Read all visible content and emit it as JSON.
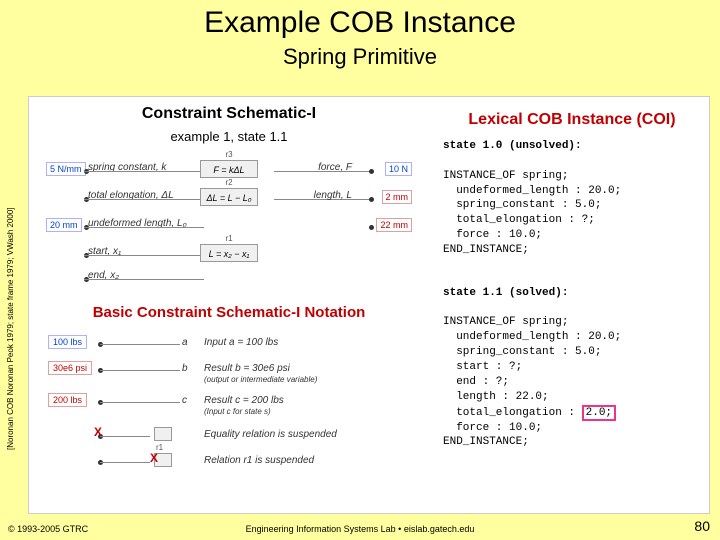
{
  "title": "Example COB Instance",
  "subtitle": "Spring Primitive",
  "sidecite": "[Noronan COB Noronan Peok 1979; state frame 1979; VWash 2000]",
  "left": {
    "heading": "Constraint Schematic-I",
    "example_label": "example 1, state 1.1",
    "rows": [
      {
        "left_tag": "5 N/mm",
        "left_label": "spring constant, k",
        "r": "r3",
        "rel": "F = kΔL",
        "right_label": "force, F",
        "right_tag": "10 N",
        "right_red": false
      },
      {
        "left_tag": "",
        "left_label": "total elongation, ΔL",
        "r": "r2",
        "rel": "ΔL = L − L₀",
        "right_label": "length, L",
        "right_tag": "2 mm",
        "right_red": true
      },
      {
        "left_tag": "20 mm",
        "left_label": "undeformed length, L₀",
        "r": "",
        "rel": "",
        "right_label": "",
        "right_tag": "22 mm",
        "right_red": true
      },
      {
        "left_tag": "",
        "left_label": "start, x₁",
        "r": "r1",
        "rel": "L = x₂ − x₁",
        "right_label": "",
        "right_tag": "",
        "right_red": false
      },
      {
        "left_tag": "",
        "left_label": "end, x₂",
        "r": "",
        "rel": "",
        "right_label": "",
        "right_tag": "",
        "right_red": false
      }
    ],
    "basic_heading": "Basic Constraint Schematic-I Notation",
    "notation": [
      {
        "box": "100 lbs",
        "box_color": "blue",
        "var": "a",
        "desc": "Input a = 100 lbs",
        "line": true,
        "dot": true
      },
      {
        "box": "30e6 psi",
        "box_color": "red",
        "var": "b",
        "desc": "Result b = 30e6 psi",
        "line": true,
        "dot": true,
        "desc2": "(output or intermediate variable)"
      },
      {
        "box": "200 lbs",
        "box_color": "red",
        "var": "c",
        "desc": "Result c = 200 lbs",
        "line": true,
        "dot": true,
        "desc2": "(Input c for state s)"
      },
      {
        "relbox": true,
        "cross_on_dot": true,
        "desc": "Equality relation is suspended"
      },
      {
        "relbox": true,
        "rlabel": "r1",
        "cross_on_box": true,
        "desc": "Relation r1 is suspended"
      }
    ]
  },
  "right": {
    "heading": "Lexical COB Instance (COI)",
    "state10_title": "state 1.0 (unsolved):",
    "state10_body": "INSTANCE_OF spring;\n  undeformed_length : 20.0;\n  spring_constant : 5.0;\n  total_elongation : ?;\n  force : 10.0;\nEND_INSTANCE;",
    "state11_title": "state 1.1 (solved):",
    "state11_body_pre": "INSTANCE_OF spring;\n  undeformed_length : 20.0;\n  spring_constant : 5.0;\n  start : ?;\n  end : ?;\n  length : 22.0;\n  total_elongation : ",
    "state11_hl": "2.0;",
    "state11_body_post": "\n  force : 10.0;\nEND_INSTANCE;"
  },
  "footer": {
    "left": "© 1993-2005 GTRC",
    "center": "Engineering Information Systems Lab  •  eislab.gatech.edu",
    "right": "80"
  }
}
